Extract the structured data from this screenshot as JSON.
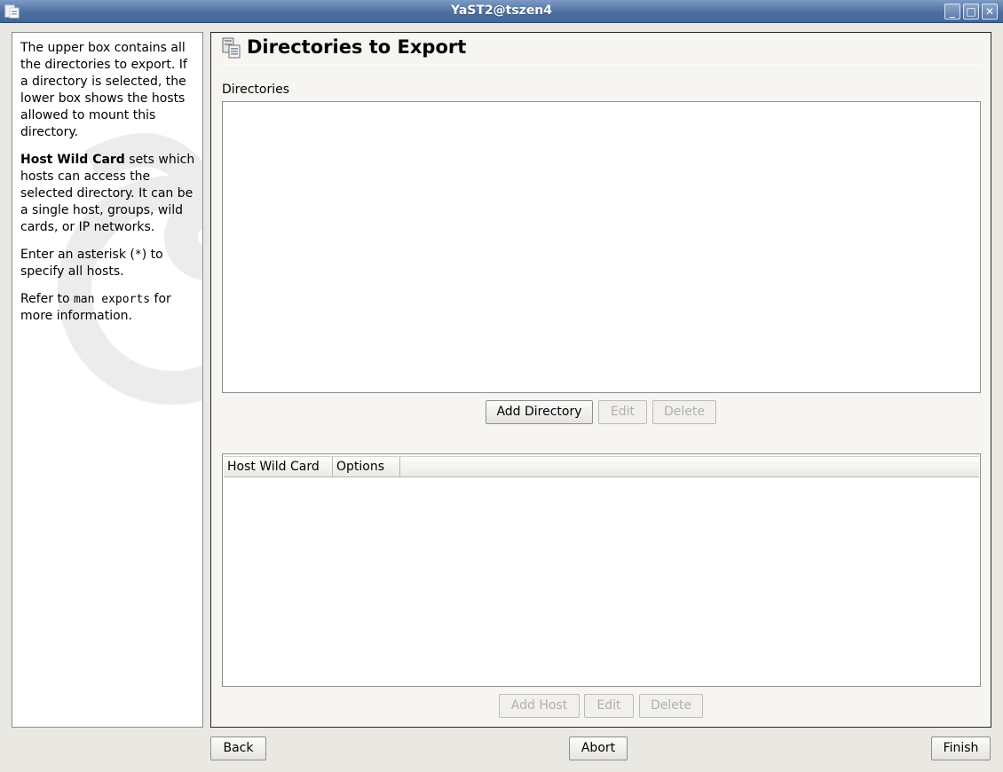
{
  "window": {
    "title": "YaST2@tszen4",
    "minimize": "_",
    "maximize": "□",
    "close": "✕"
  },
  "help": {
    "p1": "The upper box contains all the directories to export. If a directory is selected, the lower box shows the hosts allowed to mount this directory.",
    "p2_bold": "Host Wild Card",
    "p2_rest": " sets which hosts can access the selected directory. It can be a single host, groups, wild cards, or IP networks.",
    "p3_pre": "Enter an asterisk (",
    "p3_code": "*",
    "p3_post": ") to specify all hosts.",
    "p4_pre": "Refer to ",
    "p4_code": "man exports",
    "p4_post": " for more information."
  },
  "main": {
    "title": "Directories to Export",
    "directories_label": "Directories",
    "add_directory": "Add Directory",
    "edit": "Edit",
    "delete": "Delete",
    "hosts_table": {
      "columns": [
        "Host Wild Card",
        "Options"
      ],
      "rows": []
    },
    "add_host": "Add Host",
    "host_edit": "Edit",
    "host_delete": "Delete"
  },
  "footer": {
    "back": "Back",
    "abort": "Abort",
    "finish": "Finish"
  },
  "colors": {
    "titlebar": "#4d6f9f",
    "window_bg": "#eae8e3",
    "disabled_text": "#b2b0ab"
  }
}
